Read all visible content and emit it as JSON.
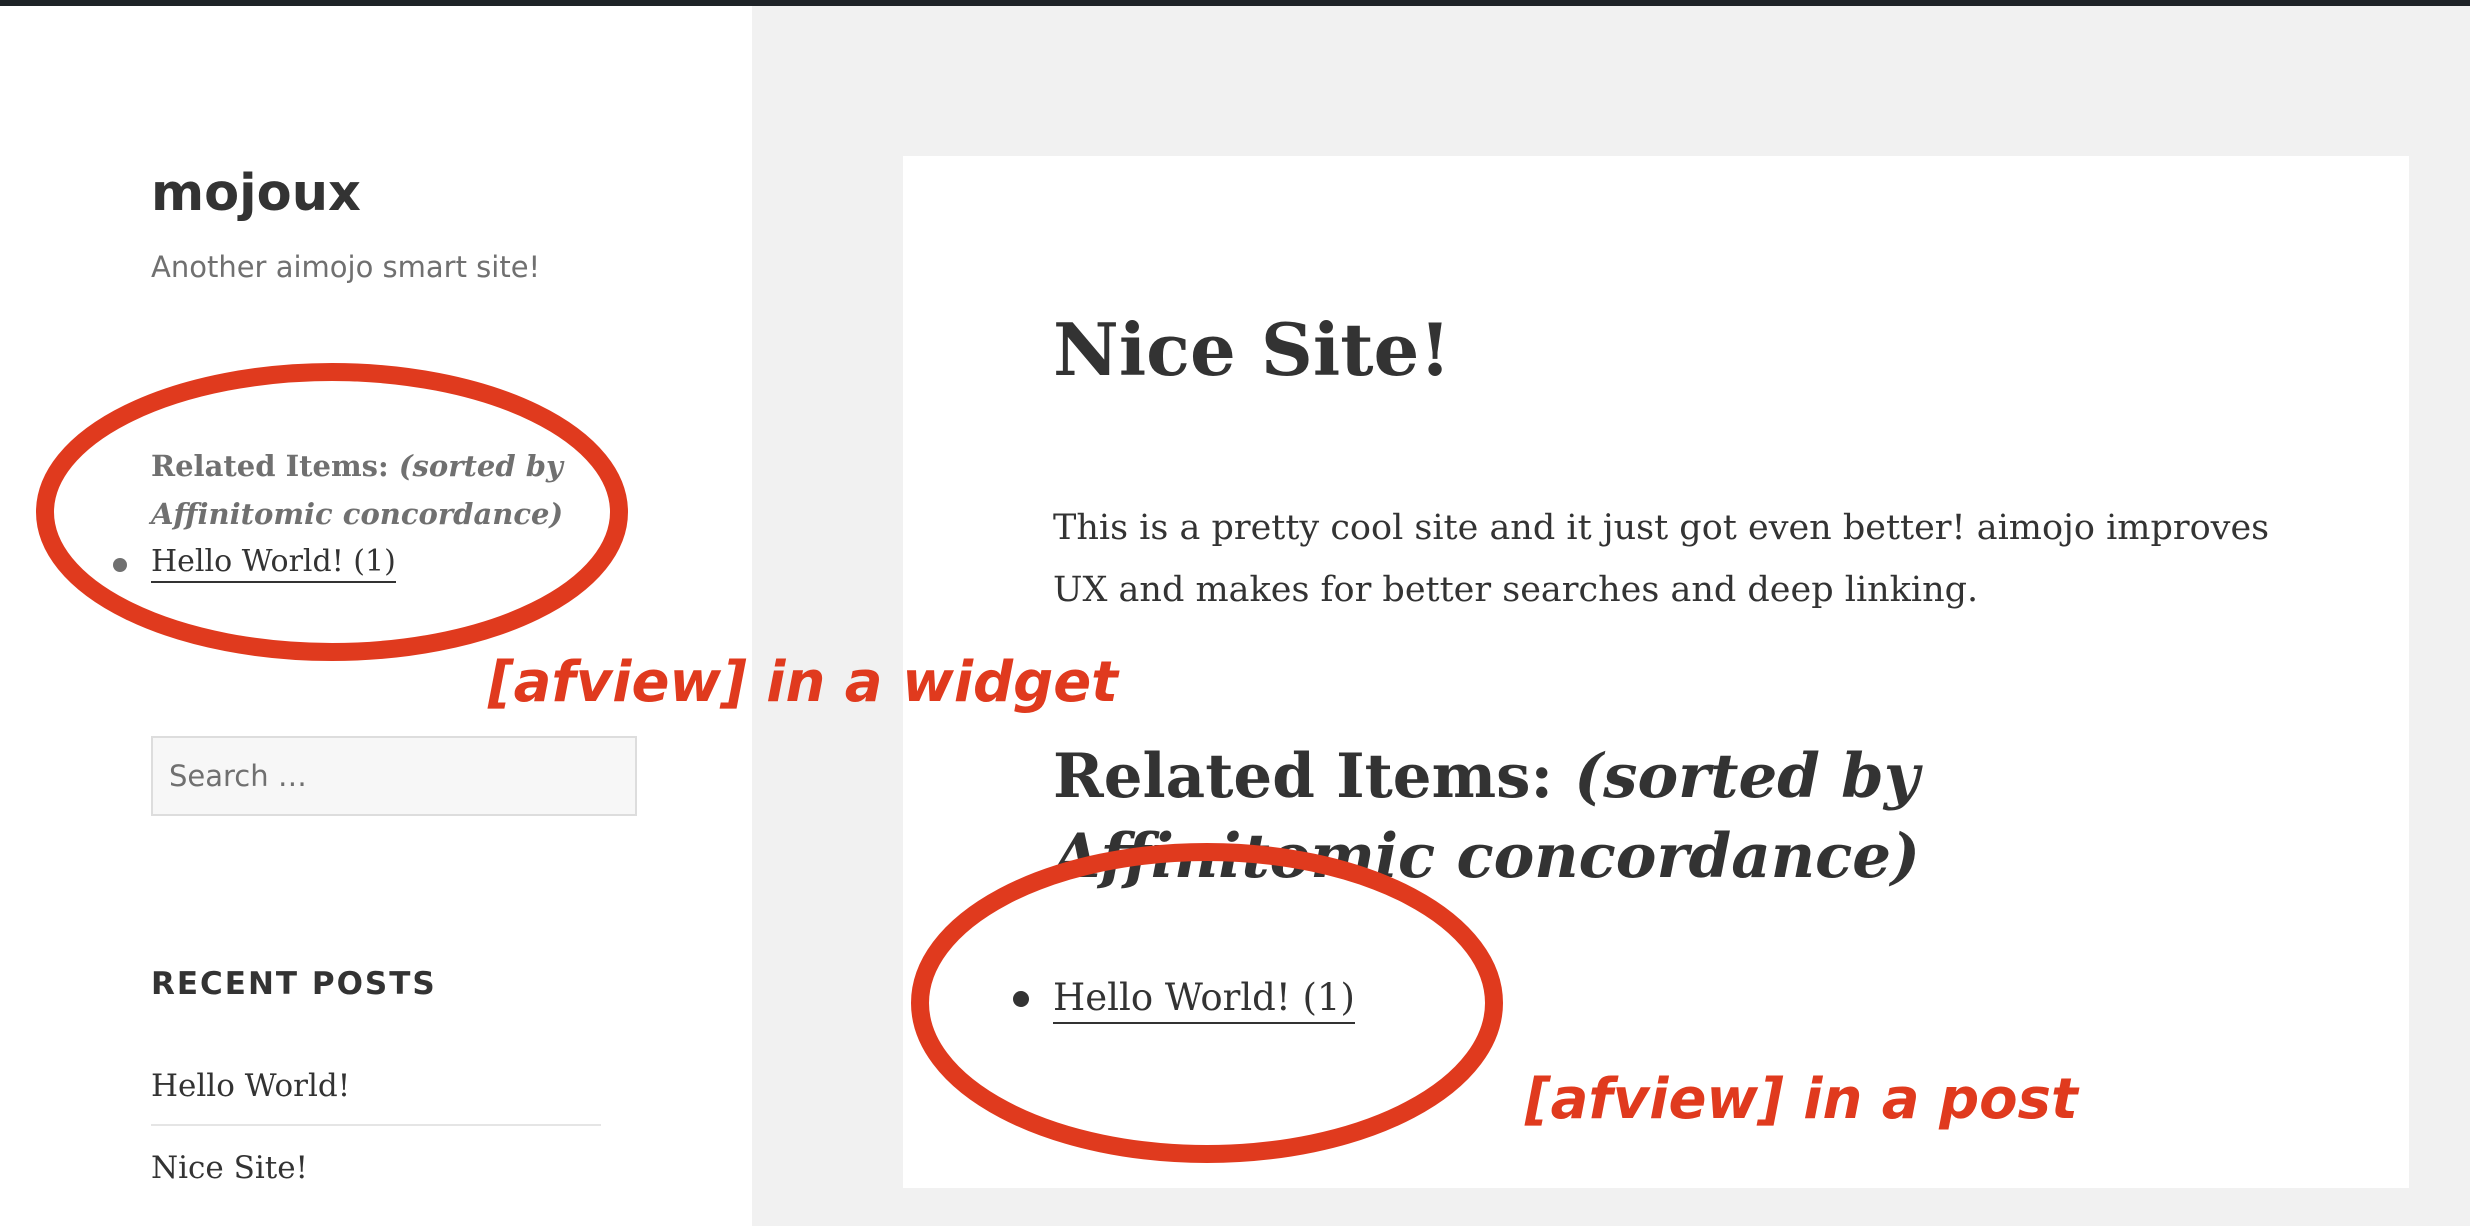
{
  "site": {
    "title": "mojoux",
    "tagline": "Another aimojo smart site!"
  },
  "sidebar": {
    "related_widget": {
      "title_prefix": "Related Items:",
      "title_sort": "(sorted by Affinitomic concordance)",
      "items": [
        {
          "label": "Hello World! (1)"
        }
      ]
    },
    "search": {
      "placeholder": "Search …"
    },
    "recent_posts": {
      "title": "RECENT POSTS",
      "items": [
        {
          "label": "Hello World!"
        },
        {
          "label": "Nice Site!"
        }
      ]
    }
  },
  "post": {
    "title": "Nice Site!",
    "body": "This is a pretty cool site and it just got even better! aimojo improves UX and makes for better searches and deep linking.",
    "related": {
      "title_prefix": "Related Items:",
      "title_sort": "(sorted by Affinitomic concordance)",
      "items": [
        {
          "label": "Hello World! (1)"
        }
      ]
    }
  },
  "annotations": {
    "widget_label": "[afview] in a widget",
    "post_label": "[afview] in a post",
    "color": "#e03a1e"
  },
  "colors": {
    "topbar": "#1e2327",
    "background": "#f1f1f1",
    "text": "#333333",
    "muted": "#707070"
  }
}
